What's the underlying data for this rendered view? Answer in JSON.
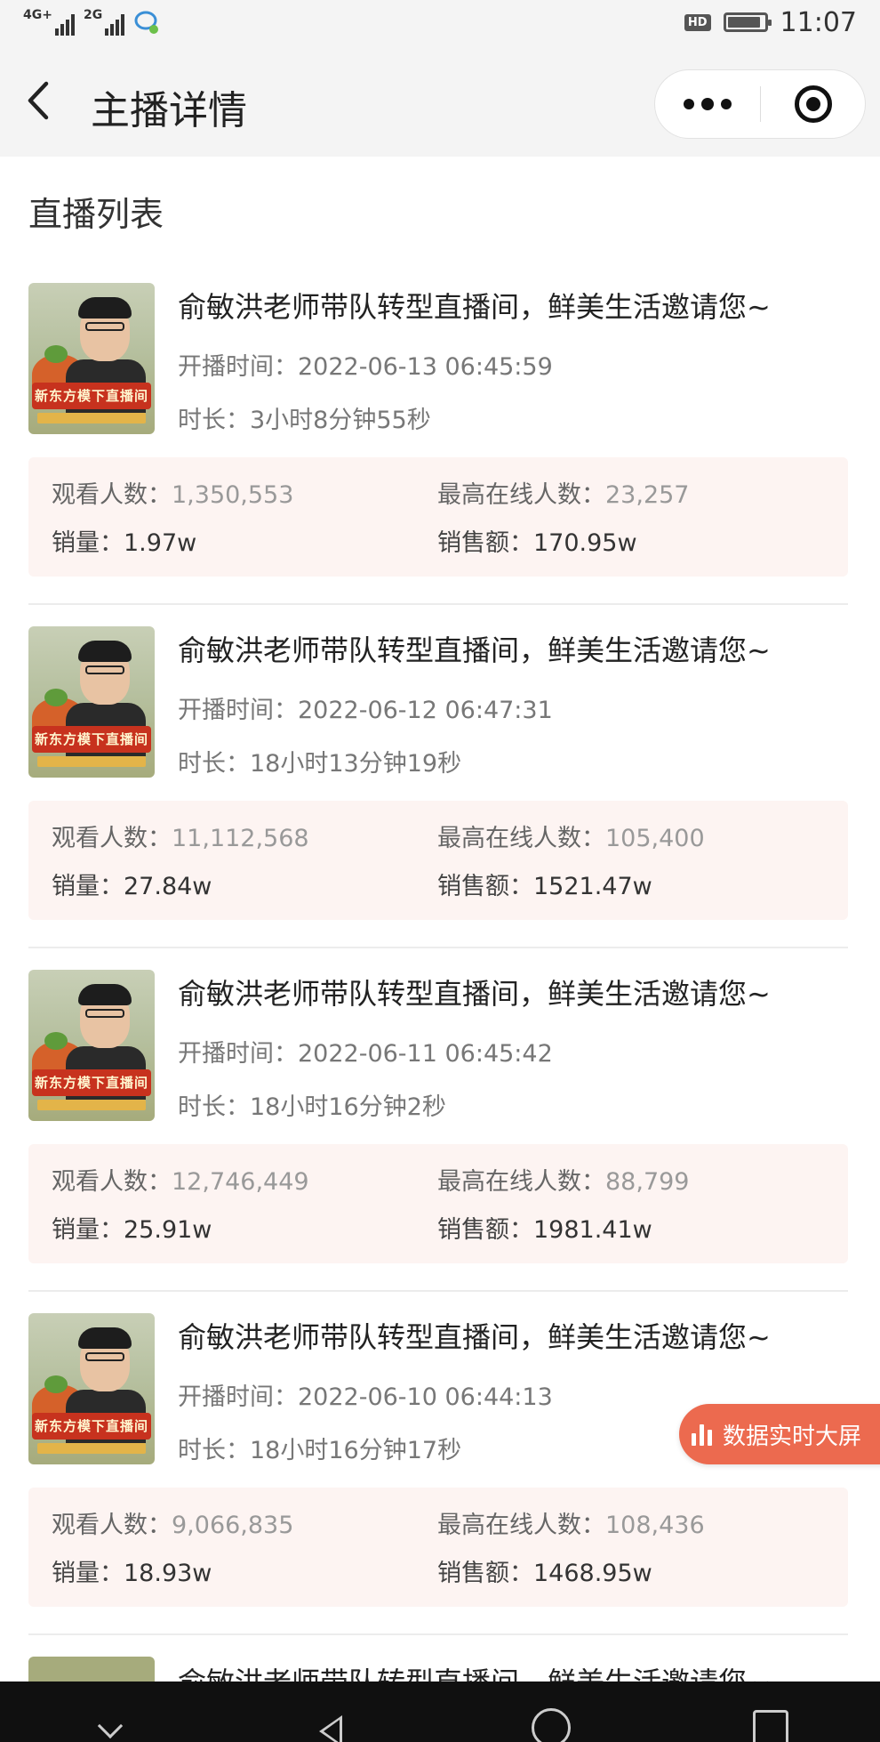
{
  "status_bar": {
    "net1": "4G+",
    "net2": "2G",
    "hd": "HD",
    "time": "11:07",
    "battery_level": 0.9
  },
  "nav": {
    "title": "主播详情"
  },
  "section_title": "直播列表",
  "labels": {
    "start_prefix": "开播时间：",
    "duration_prefix": "时长：",
    "viewers_prefix": "观看人数：",
    "peak_prefix": "最高在线人数：",
    "sales_prefix": "销量：",
    "revenue_prefix": "销售额："
  },
  "thumbnail": {
    "banner": "新东方模下直播间"
  },
  "streams": [
    {
      "title": "俞敏洪老师带队转型直播间，鲜美生活邀请您~",
      "start": "2022-06-13 06:45:59",
      "duration": "3小时8分钟55秒",
      "viewers": "1,350,553",
      "peak": "23,257",
      "sales": "1.97w",
      "revenue": "170.95w"
    },
    {
      "title": "俞敏洪老师带队转型直播间，鲜美生活邀请您~",
      "start": "2022-06-12 06:47:31",
      "duration": "18小时13分钟19秒",
      "viewers": "11,112,568",
      "peak": "105,400",
      "sales": "27.84w",
      "revenue": "1521.47w"
    },
    {
      "title": "俞敏洪老师带队转型直播间，鲜美生活邀请您~",
      "start": "2022-06-11 06:45:42",
      "duration": "18小时16分钟2秒",
      "viewers": "12,746,449",
      "peak": "88,799",
      "sales": "25.91w",
      "revenue": "1981.41w"
    },
    {
      "title": "俞敏洪老师带队转型直播间，鲜美生活邀请您~",
      "start": "2022-06-10 06:44:13",
      "duration": "18小时16分钟17秒",
      "viewers": "9,066,835",
      "peak": "108,436",
      "sales": "18.93w",
      "revenue": "1468.95w"
    },
    {
      "title": "俞敏洪老师带队转型直播间，鲜美生活邀请您~"
    }
  ],
  "float_button": {
    "label": "数据实时大屏"
  },
  "colors": {
    "accent": "#ec6a4f",
    "stats_bg": "#fdf4f2",
    "nav_bg": "#f4f4f4"
  }
}
